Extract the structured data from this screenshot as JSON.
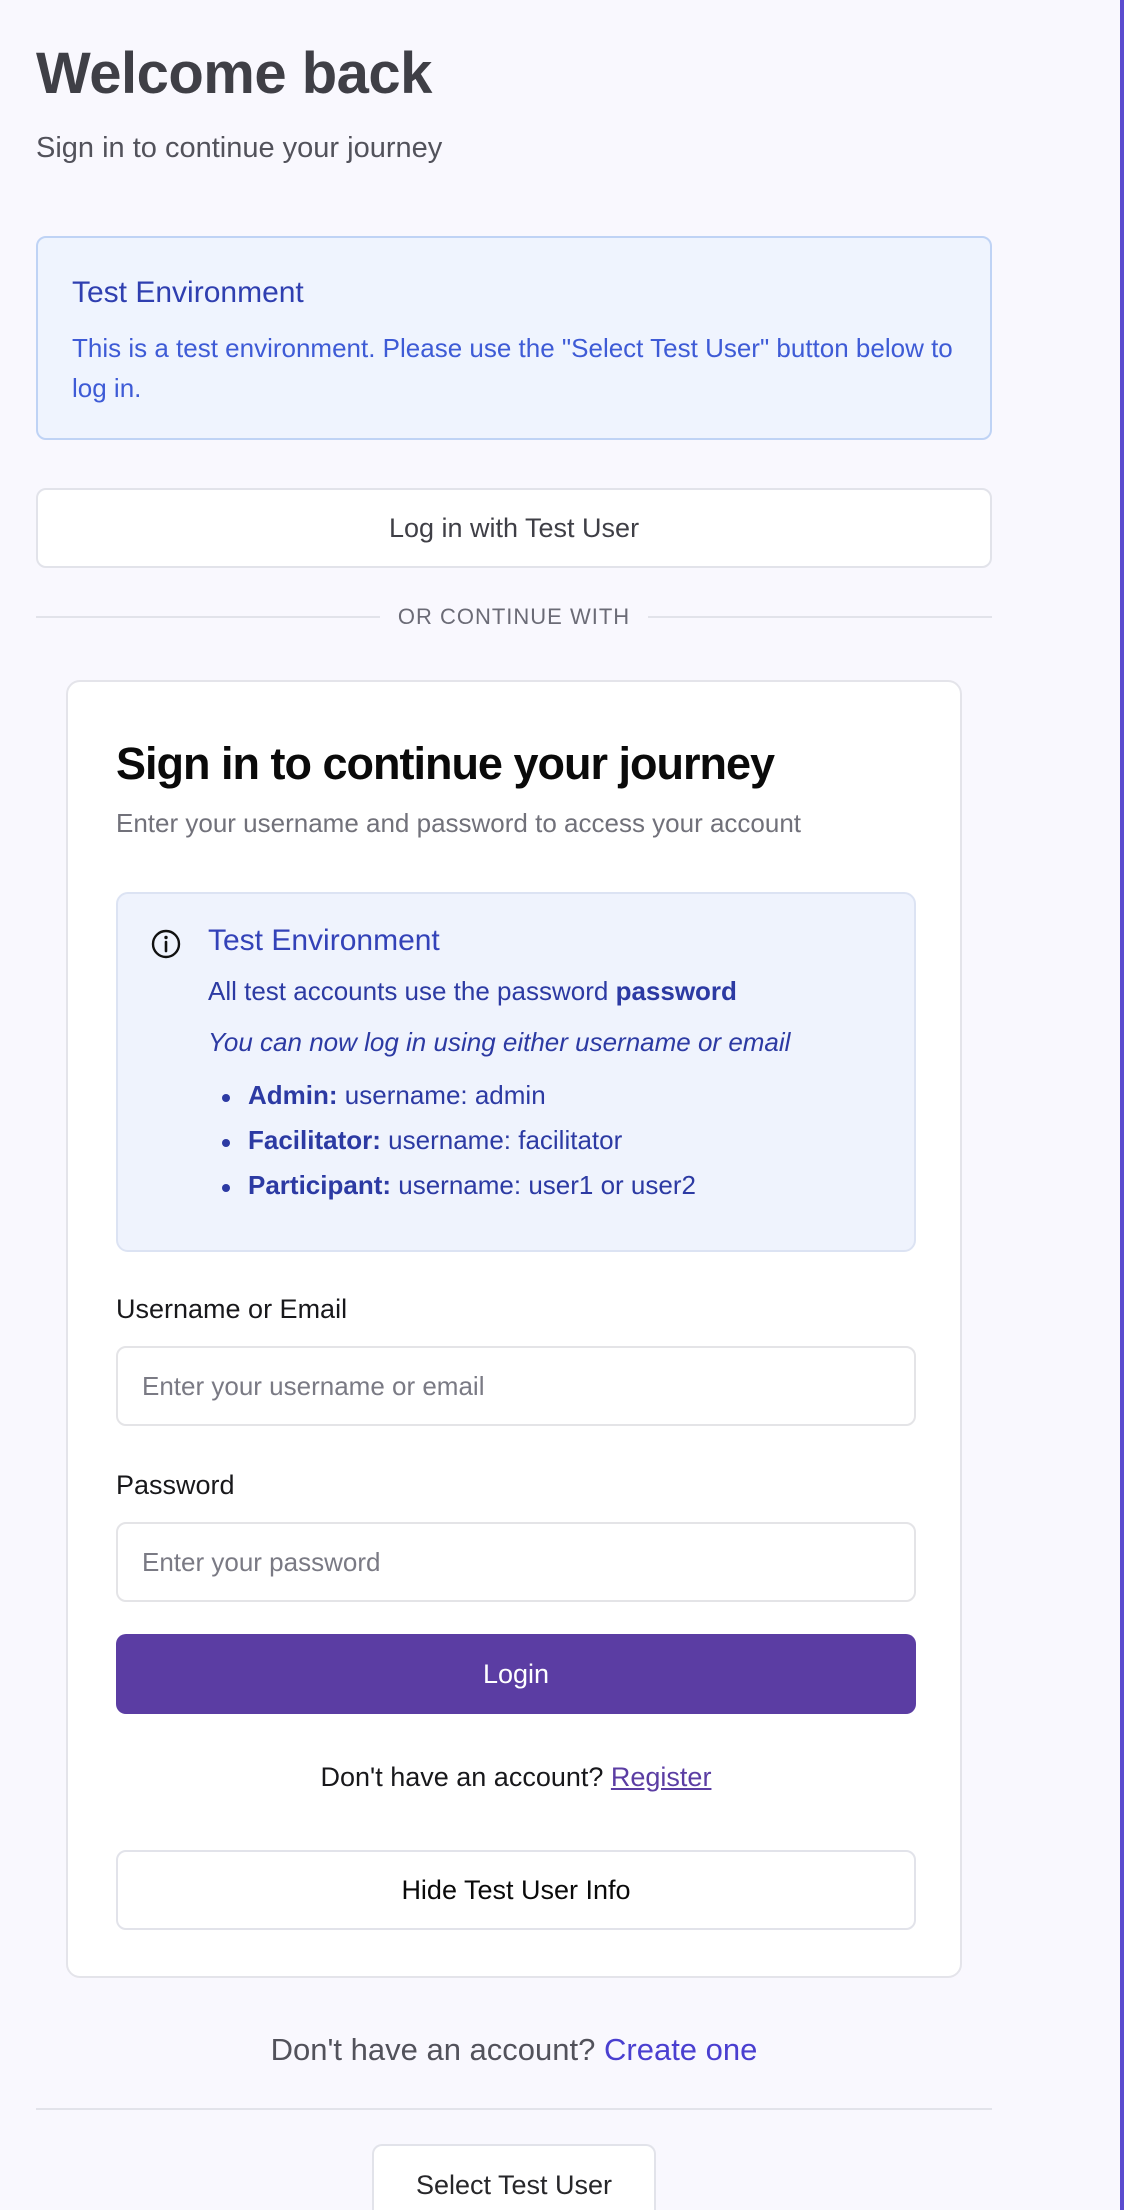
{
  "header": {
    "title": "Welcome back",
    "subtitle": "Sign in to continue your journey"
  },
  "env_banner": {
    "title": "Test Environment",
    "text": "This is a test environment. Please use the \"Select Test User\" button below to log in."
  },
  "test_login_label": "Log in with Test User",
  "divider_label": "OR CONTINUE WITH",
  "card": {
    "title": "Sign in to continue your journey",
    "subtitle": "Enter your username and password to access your account",
    "info": {
      "title": "Test Environment",
      "password_prefix": "All test accounts use the password",
      "password_value": "password",
      "note": "You can now log in using either username or email",
      "accounts": [
        {
          "role": "Admin:",
          "detail": "username: admin"
        },
        {
          "role": "Facilitator:",
          "detail": "username: facilitator"
        },
        {
          "role": "Participant:",
          "detail": "username: user1 or user2"
        }
      ]
    },
    "username": {
      "label": "Username or Email",
      "value": "",
      "placeholder": "Enter your username or email"
    },
    "password": {
      "label": "Password",
      "value": "",
      "placeholder": "Enter your password"
    },
    "login_label": "Login",
    "register_prompt": "Don't have an account?",
    "register_link": "Register",
    "hide_info_label": "Hide Test User Info"
  },
  "footer": {
    "prompt": "Don't have an account?",
    "link": "Create one",
    "select_test_user_label": "Select Test User"
  },
  "colors": {
    "primary": "#5b3da3",
    "accent_link": "#4a3fd0",
    "info_text": "#2c3aa3",
    "page_bg": "#f9f8fe"
  },
  "icons": {
    "info": "info-circle-icon"
  }
}
